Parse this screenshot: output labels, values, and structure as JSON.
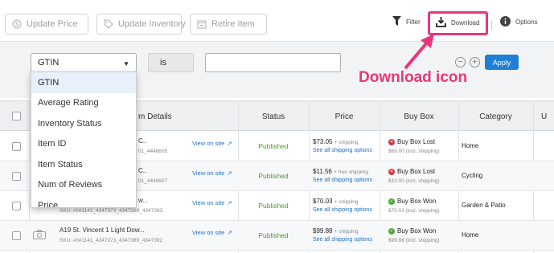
{
  "toolbar": {
    "update_price": "Update Price",
    "update_inventory": "Update Inventory",
    "retire_item": "Retire Item",
    "filter": "Filter",
    "download": "Download",
    "options": "Options"
  },
  "annotation": "Download icon",
  "filter_row": {
    "field_selected": "GTIN",
    "operator": "is",
    "value": "",
    "apply": "Apply"
  },
  "dropdown_options": [
    "GTIN",
    "Average Rating",
    "Inventory Status",
    "Item ID",
    "Item Status",
    "Num of Reviews",
    "Price"
  ],
  "table": {
    "headers": {
      "item_details": "m Details",
      "status": "Status",
      "price": "Price",
      "buy_box": "Buy Box",
      "category": "Category",
      "extra": "U"
    },
    "rows": [
      {
        "name": "C..",
        "sku": "01_4448605",
        "view": "View on site",
        "status": "Published",
        "price": "$73.05",
        "shipping_note": "+ shipping",
        "shipping_link": "See all shipping options",
        "buybox": "Buy Box Lost",
        "buybox_price": "$69.00 (incl. shipping)",
        "buybox_won": false,
        "category": "Home"
      },
      {
        "name": "C..",
        "sku": "01_4448607",
        "view": "View on site",
        "status": "Published",
        "price": "$11.56",
        "shipping_note": "+ free shipping",
        "shipping_link": "See all shipping options",
        "buybox": "Buy Box Lost",
        "buybox_price": "$10.00 (incl. shipping)",
        "buybox_won": false,
        "category": "Cycling"
      },
      {
        "name": "w...",
        "sku": "SKU: ANI1141_4347373_4347389_4347393",
        "view": "View on site",
        "status": "Published",
        "price": "$70.03",
        "shipping_note": "+ shipping",
        "shipping_link": "See all shipping options",
        "buybox": "Buy Box Won",
        "buybox_price": "$70.03 (incl. shipping)",
        "buybox_won": true,
        "category": "Garden & Patio"
      },
      {
        "name": "A19 St. Vincent 1 Light Dow...",
        "sku": "SKU: ANI1141_4347373_4347389_4347392",
        "view": "View on site",
        "status": "Published",
        "price": "$99.88",
        "shipping_note": "+ shipping",
        "shipping_link": "See all shipping options",
        "buybox": "Buy Box Won",
        "buybox_price": "$99.88 (incl. shipping)",
        "buybox_won": true,
        "category": "Home"
      }
    ]
  },
  "colors": {
    "accent": "#1e7fd6",
    "annotation": "#e8367d",
    "published": "#4c9a2a",
    "buybox_lost": "#d9343a",
    "buybox_won": "#4fa83d"
  }
}
